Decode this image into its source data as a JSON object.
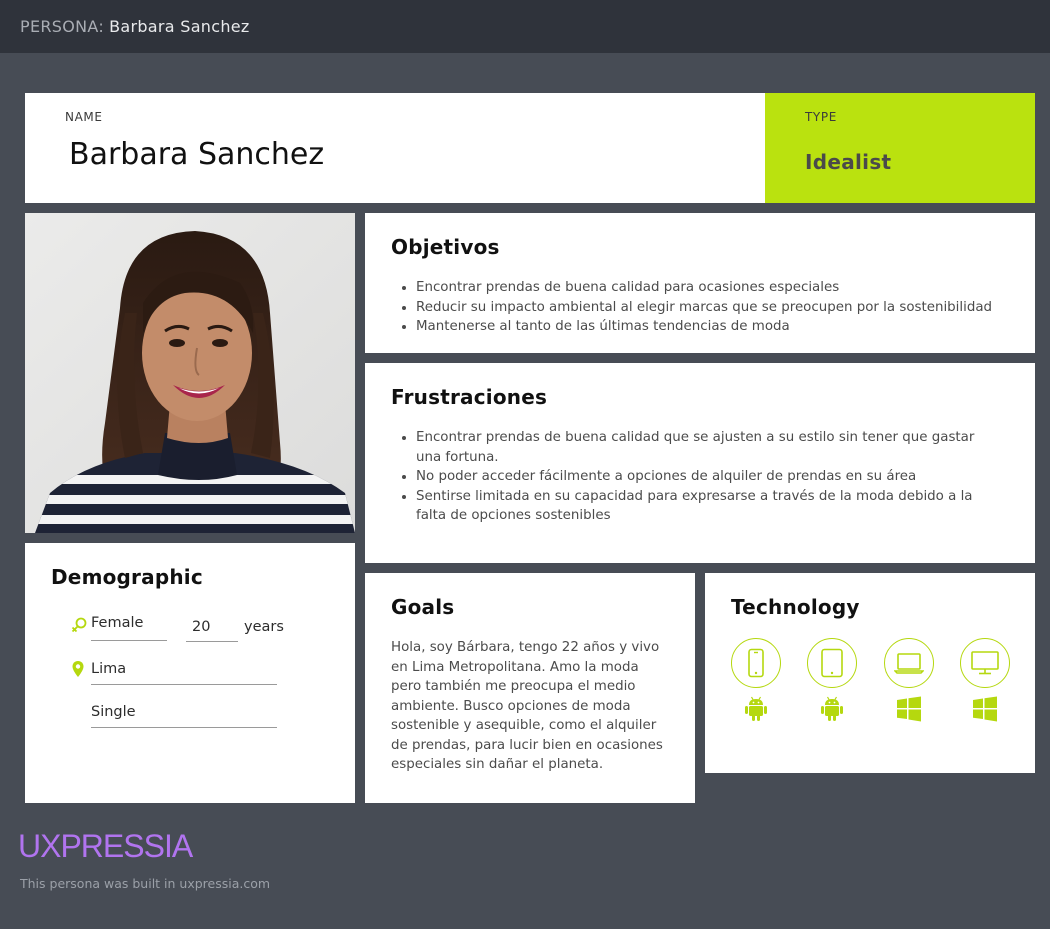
{
  "header": {
    "prefix": "PERSONA:",
    "persona_name": "Barbara Sanchez"
  },
  "name_card": {
    "label": "NAME",
    "value": "Barbara Sanchez"
  },
  "type_card": {
    "label": "TYPE",
    "value": "Idealist",
    "color": "#bae20f"
  },
  "objetivos": {
    "title": "Objetivos",
    "items": [
      "Encontrar prendas de buena calidad para ocasiones especiales",
      "Reducir su impacto ambiental al elegir marcas que se preocupen por la sostenibilidad",
      "Mantenerse al tanto de las últimas tendencias de moda"
    ]
  },
  "frustraciones": {
    "title": "Frustraciones",
    "items": [
      "Encontrar prendas de buena calidad que se ajusten a su estilo sin tener que gastar una fortuna.",
      "No poder acceder fácilmente a opciones de alquiler de prendas en su área",
      "Sentirse limitada en su capacidad para expresarse a través de la moda debido a la falta de opciones sostenibles"
    ]
  },
  "demographic": {
    "title": "Demographic",
    "gender": "Female",
    "age": "20",
    "age_unit": "years",
    "location": "Lima",
    "status": "Single",
    "gender_icon": "gender-female-male-icon",
    "location_icon": "map-pin-icon"
  },
  "goals": {
    "title": "Goals",
    "text": "Hola, soy Bárbara, tengo 22 años y vivo en Lima Metropolitana. Amo la moda pero también me preocupa el medio ambiente. Busco opciones de moda sostenible y asequible, como el alquiler de prendas, para lucir bien en ocasiones especiales sin dañar el planeta."
  },
  "technology": {
    "title": "Technology",
    "devices": [
      {
        "device": "smartphone-icon",
        "os": "android-icon"
      },
      {
        "device": "tablet-icon",
        "os": "android-icon"
      },
      {
        "device": "laptop-icon",
        "os": "windows-icon"
      },
      {
        "device": "desktop-icon",
        "os": "windows-icon"
      }
    ],
    "accent": "#b5d80f"
  },
  "footer": {
    "brand": "UXPRESSIA",
    "note": "This persona was built in uxpressia.com",
    "brand_color": "#b174ef"
  }
}
